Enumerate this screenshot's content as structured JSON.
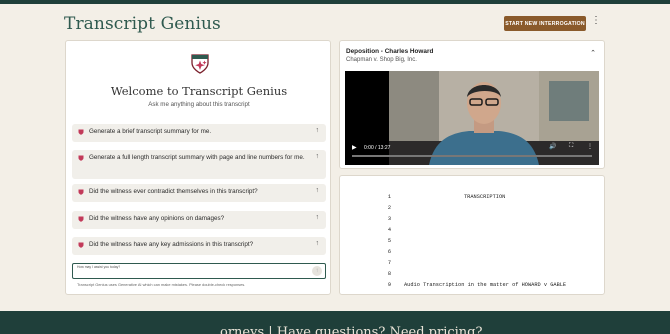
{
  "app": {
    "title": "Transcript Genius"
  },
  "header": {
    "start_button": "START NEW INTERROGATION",
    "more_icon": "more-vertical-icon"
  },
  "chat": {
    "welcome": "Welcome to Transcript Genius",
    "subtitle": "Ask me anything about this transcript",
    "suggestions": [
      {
        "text": "Generate a brief transcript summary for me."
      },
      {
        "text": "Generate a full length transcript summary with page and line numbers for me."
      },
      {
        "text": "Did the witness ever contradict themselves in this transcript?"
      },
      {
        "text": "Did the witness have any opinions on damages?"
      },
      {
        "text": "Did the witness have any key admissions in this transcript?"
      }
    ],
    "input_label": "How may I assist you today?",
    "disclaimer": "Transcript Genius uses Generative AI which can make mistakes. Please double-check responses."
  },
  "deposition": {
    "title": "Deposition - Charles Howard",
    "case": "Chapman v. Shop Big, Inc.",
    "video": {
      "time": "0:00 / 13:27"
    }
  },
  "transcript": {
    "heading": "TRANSCRIPTION",
    "line_numbers": [
      "1",
      "2",
      "3",
      "4",
      "5",
      "6",
      "7",
      "8",
      "9"
    ],
    "line9_text": "Audio Transcription in the matter of HOWARD v GABLE"
  },
  "footer": {
    "text": "orneys |   Have questions? Need pricing? "
  },
  "colors": {
    "brand": "#2f5a4f",
    "accent": "#8a5a2b",
    "dark": "#1f3f3a",
    "background": "#f3efe7"
  }
}
